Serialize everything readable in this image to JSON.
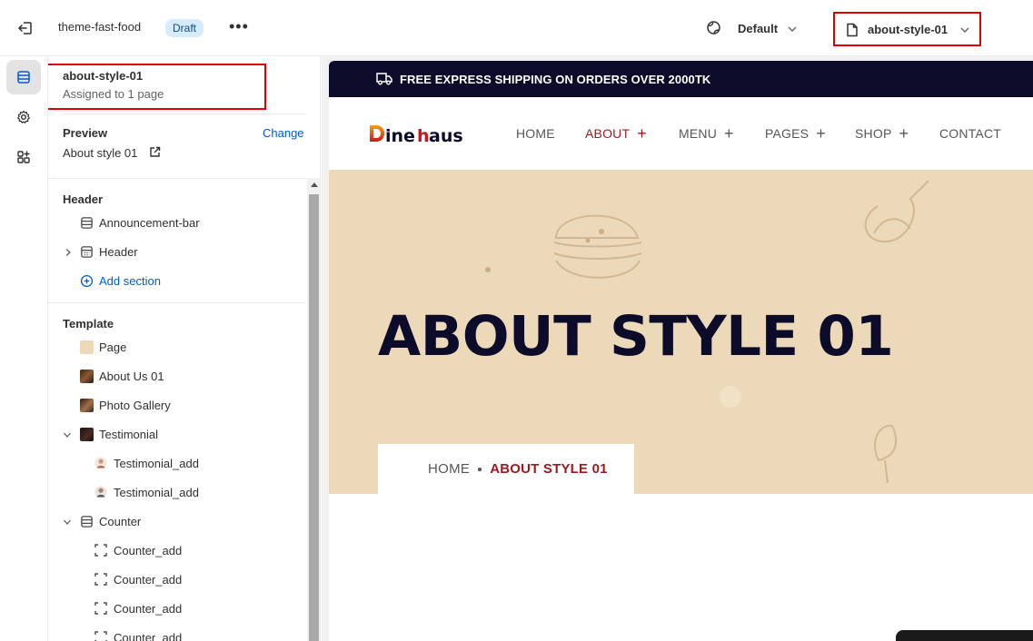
{
  "topbar": {
    "theme_name": "theme-fast-food",
    "status_badge": "Draft",
    "more_label": "•••",
    "language_label": "Default",
    "template_selector": "about-style-01"
  },
  "sidebar": {
    "template_name": "about-style-01",
    "assigned_text": "Assigned to 1 page",
    "preview_label": "Preview",
    "preview_change": "Change",
    "preview_value": "About style 01",
    "header_section": {
      "title": "Header",
      "items": [
        "Announcement-bar",
        "Header"
      ],
      "add_section": "Add section"
    },
    "template_section": {
      "title": "Template",
      "items": [
        {
          "label": "Page"
        },
        {
          "label": "About Us 01"
        },
        {
          "label": "Photo Gallery"
        },
        {
          "label": "Testimonial"
        },
        {
          "label": "Testimonial_add"
        },
        {
          "label": "Testimonial_add"
        },
        {
          "label": "Counter"
        },
        {
          "label": "Counter_add"
        },
        {
          "label": "Counter_add"
        },
        {
          "label": "Counter_add"
        },
        {
          "label": "Counter_add"
        }
      ]
    }
  },
  "preview": {
    "announcement": "FREE EXPRESS SHIPPING ON ORDERS OVER 2000TK",
    "logo_text": "Dinehaus",
    "nav": [
      "HOME",
      "ABOUT",
      "MENU",
      "PAGES",
      "SHOP",
      "CONTACT"
    ],
    "nav_plus": "+",
    "hero_title": "ABOUT STYLE 01",
    "breadcrumb_home": "HOME",
    "breadcrumb_current": "ABOUT STYLE 01"
  },
  "colors": {
    "highlight_box": "#e00000",
    "accent_red": "#a0191f",
    "navy": "#0d0b2a",
    "hero_bg": "#ecd9b9",
    "link_blue": "#005bd3"
  }
}
